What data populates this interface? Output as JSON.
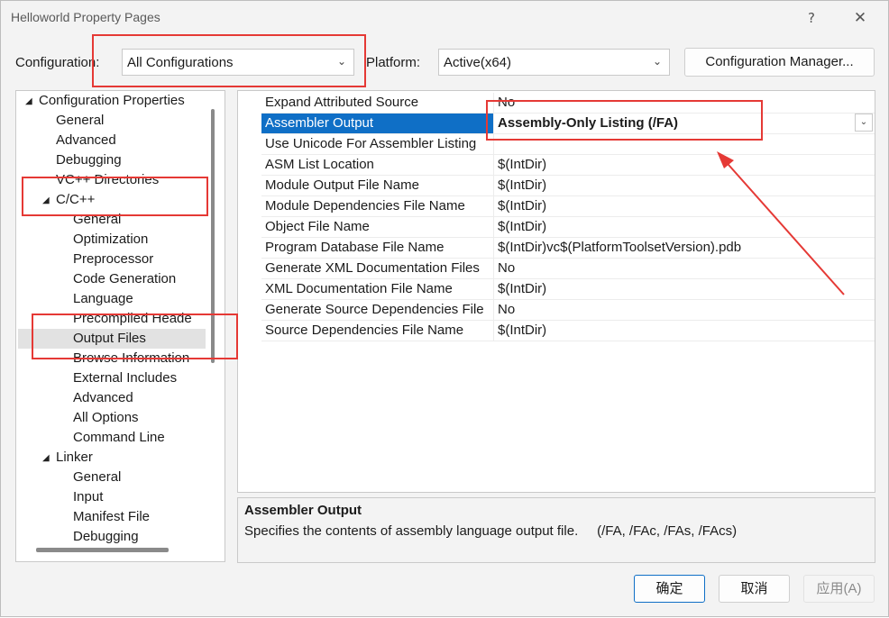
{
  "window": {
    "title": "Helloworld Property Pages",
    "help": "?",
    "close": "✕"
  },
  "toolbar": {
    "configuration_label": "Configuration:",
    "configuration_value": "All Configurations",
    "platform_label": "Platform:",
    "platform_value": "Active(x64)",
    "config_manager_button": "Configuration Manager..."
  },
  "tree": {
    "items": [
      {
        "label": "Configuration Properties"
      },
      {
        "label": "General"
      },
      {
        "label": "Advanced"
      },
      {
        "label": "Debugging"
      },
      {
        "label": "VC++ Directories"
      },
      {
        "label": "C/C++"
      },
      {
        "label": "General"
      },
      {
        "label": "Optimization"
      },
      {
        "label": "Preprocessor"
      },
      {
        "label": "Code Generation"
      },
      {
        "label": "Language"
      },
      {
        "label": "Precompiled Heade"
      },
      {
        "label": "Output Files"
      },
      {
        "label": "Browse Information"
      },
      {
        "label": "External Includes"
      },
      {
        "label": "Advanced"
      },
      {
        "label": "All Options"
      },
      {
        "label": "Command Line"
      },
      {
        "label": "Linker"
      },
      {
        "label": "General"
      },
      {
        "label": "Input"
      },
      {
        "label": "Manifest File"
      },
      {
        "label": "Debugging"
      }
    ]
  },
  "properties": {
    "rows": [
      {
        "name": "Expand Attributed Source",
        "value": "No"
      },
      {
        "name": "Assembler Output",
        "value": "Assembly-Only Listing (/FA)"
      },
      {
        "name": "Use Unicode For Assembler Listing",
        "value": ""
      },
      {
        "name": "ASM List Location",
        "value": "$(IntDir)"
      },
      {
        "name": "Module Output File Name",
        "value": "$(IntDir)"
      },
      {
        "name": "Module Dependencies File Name",
        "value": "$(IntDir)"
      },
      {
        "name": "Object File Name",
        "value": "$(IntDir)"
      },
      {
        "name": "Program Database File Name",
        "value": "$(IntDir)vc$(PlatformToolsetVersion).pdb"
      },
      {
        "name": "Generate XML Documentation Files",
        "value": "No"
      },
      {
        "name": "XML Documentation File Name",
        "value": "$(IntDir)"
      },
      {
        "name": "Generate Source Dependencies File",
        "value": "No"
      },
      {
        "name": "Source Dependencies File Name",
        "value": "$(IntDir)"
      }
    ]
  },
  "description": {
    "title": "Assembler Output",
    "text": "Specifies the contents of assembly language output file.     (/FA, /FAc, /FAs, /FAcs)"
  },
  "buttons": {
    "ok": "确定",
    "cancel": "取消",
    "apply": "应用(A)"
  },
  "colors": {
    "selection": "#0f6fc6",
    "annotation": "#e53935"
  }
}
